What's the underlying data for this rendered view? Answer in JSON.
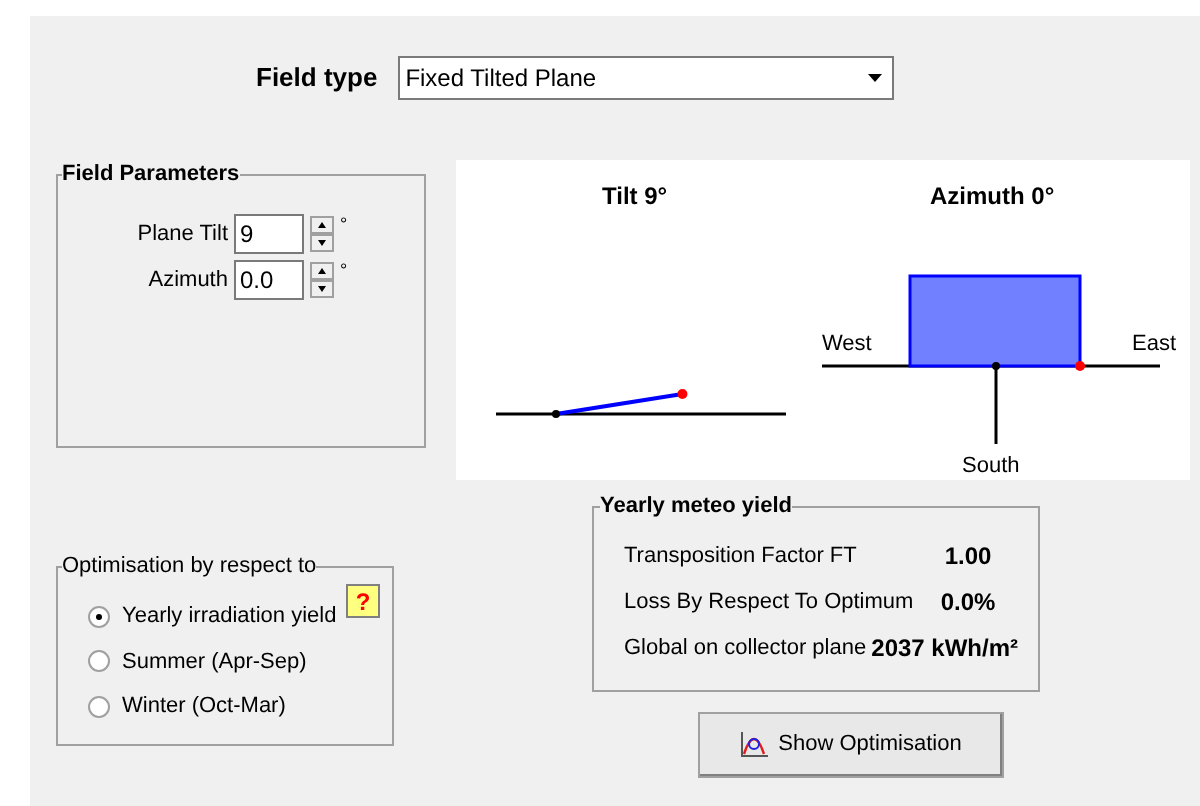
{
  "field_type": {
    "label": "Field type",
    "value": "Fixed Tilted Plane"
  },
  "field_parameters": {
    "title": "Field Parameters",
    "fields": [
      {
        "label": "Plane Tilt",
        "value": "9",
        "unit": "°"
      },
      {
        "label": "Azimuth",
        "value": "0.0",
        "unit": "°"
      }
    ]
  },
  "diagram": {
    "tilt_title": "Tilt 9°",
    "azimuth_title": "Azimuth 0°",
    "west": "West",
    "east": "East",
    "south": "South"
  },
  "optimisation": {
    "title": "Optimisation by respect to",
    "help": "?",
    "options": [
      {
        "label": "Yearly irradiation yield",
        "selected": true
      },
      {
        "label": "Summer (Apr-Sep)",
        "selected": false
      },
      {
        "label": "Winter (Oct-Mar)",
        "selected": false
      }
    ]
  },
  "yield": {
    "title": "Yearly meteo yield",
    "rows": [
      {
        "label": "Transposition Factor FT",
        "value": "1.00"
      },
      {
        "label": "Loss By Respect To Optimum",
        "value": "0.0%"
      },
      {
        "label": "Global on collector plane",
        "value": "2037 kWh/m²"
      }
    ]
  },
  "button": "Show Optimisation"
}
